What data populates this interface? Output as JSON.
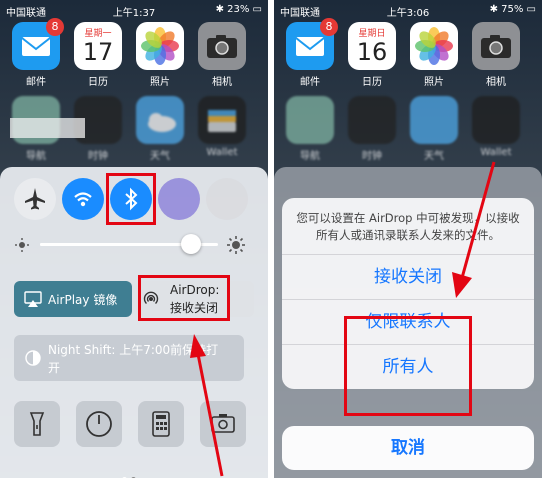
{
  "left": {
    "status": {
      "carrier": "中国联通",
      "time": "上午1:37",
      "battery": "23%"
    },
    "apps": [
      {
        "label": "邮件",
        "badge": "8",
        "icon": "mail-icon",
        "color": "#1e9bf0"
      },
      {
        "label": "日历",
        "badge": "",
        "icon": "calendar-icon",
        "color": "#ffffff",
        "weekday": "星期一",
        "day": "17"
      },
      {
        "label": "照片",
        "badge": "",
        "icon": "photos-icon",
        "color": "#ffffff"
      },
      {
        "label": "相机",
        "badge": "",
        "icon": "camera-icon",
        "color": "#8e9094"
      }
    ],
    "row2": [
      {
        "label": "导航"
      },
      {
        "label": "时钟"
      },
      {
        "label": "天气"
      },
      {
        "label": "Wallet"
      }
    ],
    "control_center": {
      "airplay_label": "AirPlay 镜像",
      "airdrop_title": "AirDrop:",
      "airdrop_status": "接收关闭",
      "night_shift_title": "Night Shift:",
      "night_shift_detail": "上午7:00前保持打",
      "night_shift_detail2": "开",
      "brightness": 0.85
    }
  },
  "right": {
    "status": {
      "carrier": "中国联通",
      "time": "上午3:06",
      "battery": "75%"
    },
    "apps": [
      {
        "label": "邮件",
        "badge": "8"
      },
      {
        "label": "日历",
        "weekday": "星期日",
        "day": "16"
      },
      {
        "label": "照片"
      },
      {
        "label": "相机"
      }
    ],
    "row2": [
      {
        "label": "导航"
      },
      {
        "label": "时钟"
      },
      {
        "label": "天气"
      },
      {
        "label": "Wallet"
      }
    ],
    "airdrop_sheet": {
      "message": "您可以设置在 AirDrop 中可被发现，以接收所有人或通讯录联系人发来的文件。",
      "options": [
        "接收关闭",
        "仅限联系人",
        "所有人"
      ],
      "cancel": "取消"
    }
  },
  "colors": {
    "highlight": "#e30613",
    "ios_blue": "#1677ff",
    "toggle_blue": "#1a8cff"
  }
}
